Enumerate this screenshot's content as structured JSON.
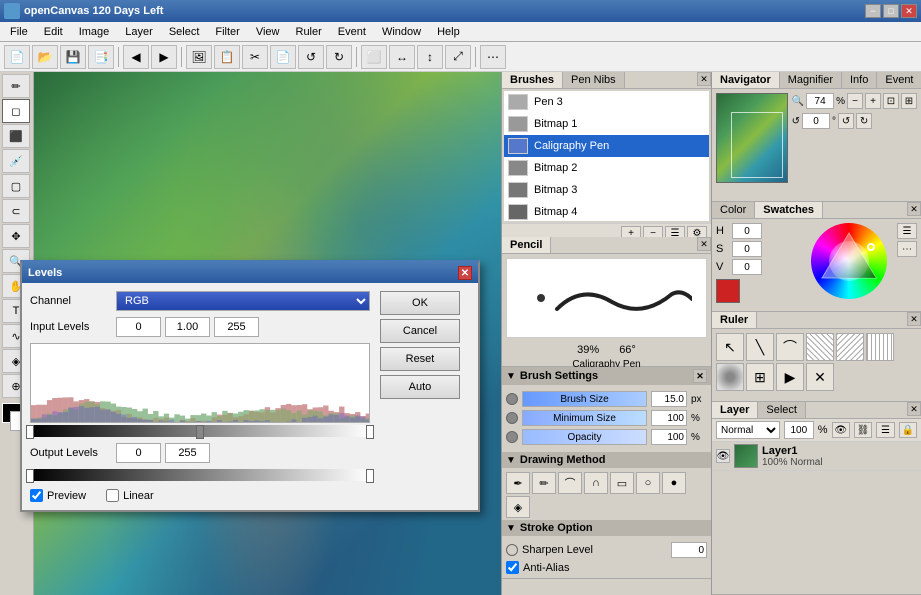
{
  "app": {
    "title": "openCanvas 120 Days Left",
    "icon": "◆"
  },
  "titlebar": {
    "minimize": "−",
    "maximize": "□",
    "close": "✕"
  },
  "menu": {
    "items": [
      "File",
      "Edit",
      "Image",
      "Layer",
      "Select",
      "Filter",
      "View",
      "Ruler",
      "Event",
      "Window",
      "Help"
    ]
  },
  "toolbar": {
    "buttons": [
      "📄",
      "📂",
      "💾",
      "🖫",
      "◀",
      "▶",
      "🖼",
      "📋",
      "✂",
      "🖂",
      "↺",
      "↻",
      "⬜"
    ]
  },
  "brushes_panel": {
    "title": "Brushes",
    "tabs": [
      "Brushes",
      "Pen Nibs"
    ],
    "items": [
      {
        "name": "Pen 3",
        "selected": false
      },
      {
        "name": "Bitmap 1",
        "selected": false
      },
      {
        "name": "Caligraphy Pen",
        "selected": true
      },
      {
        "name": "Bitmap 2",
        "selected": false
      },
      {
        "name": "Bitmap 3",
        "selected": false
      },
      {
        "name": "Bitmap 4",
        "selected": false
      }
    ]
  },
  "navigator": {
    "tabs": [
      "Navigator",
      "Magnifier",
      "Info",
      "Event"
    ],
    "zoom": "74",
    "zoom_unit": "%",
    "rotation": "0",
    "rotation_unit": "°"
  },
  "color_panel": {
    "tabs": [
      "Color",
      "Swatches"
    ],
    "active_tab": "Swatches",
    "h": "0",
    "s": "0",
    "v": "0"
  },
  "pencil_panel": {
    "title": "Pencil",
    "percent": "39%",
    "degrees": "66°"
  },
  "brush_settings": {
    "title": "Brush Settings",
    "brush_size_label": "Brush Size",
    "brush_size_val": "15.0",
    "brush_size_unit": "px",
    "min_size_label": "Minimum Size",
    "min_size_val": "100",
    "min_size_unit": "%",
    "opacity_label": "Opacity",
    "opacity_val": "100",
    "opacity_unit": "%"
  },
  "drawing_method": {
    "title": "Drawing Method"
  },
  "stroke_option": {
    "title": "Stroke Option",
    "sharpen_label": "Sharpen Level",
    "sharpen_val": "0",
    "anti_alias": "Anti-Alias"
  },
  "ruler_panel": {
    "title": "Ruler",
    "tabs": [
      "Ruler"
    ]
  },
  "layer_panel": {
    "tabs": [
      "Layer",
      "Select"
    ],
    "blend_mode": "Normal",
    "opacity": "100",
    "opacity_unit": "%",
    "layer": {
      "name": "Layer1",
      "desc": "100% Normal",
      "visible": true
    }
  },
  "levels_dialog": {
    "title": "Levels",
    "channel_label": "Channel",
    "channel_value": "RGB",
    "input_label": "Input Levels",
    "input_val1": "0",
    "input_val2": "1.00",
    "input_val3": "255",
    "output_label": "Output Levels",
    "output_val1": "0",
    "output_val2": "255",
    "buttons": {
      "ok": "OK",
      "cancel": "Cancel",
      "reset": "Reset",
      "auto": "Auto"
    },
    "preview_label": "Preview",
    "linear_label": "Linear"
  }
}
